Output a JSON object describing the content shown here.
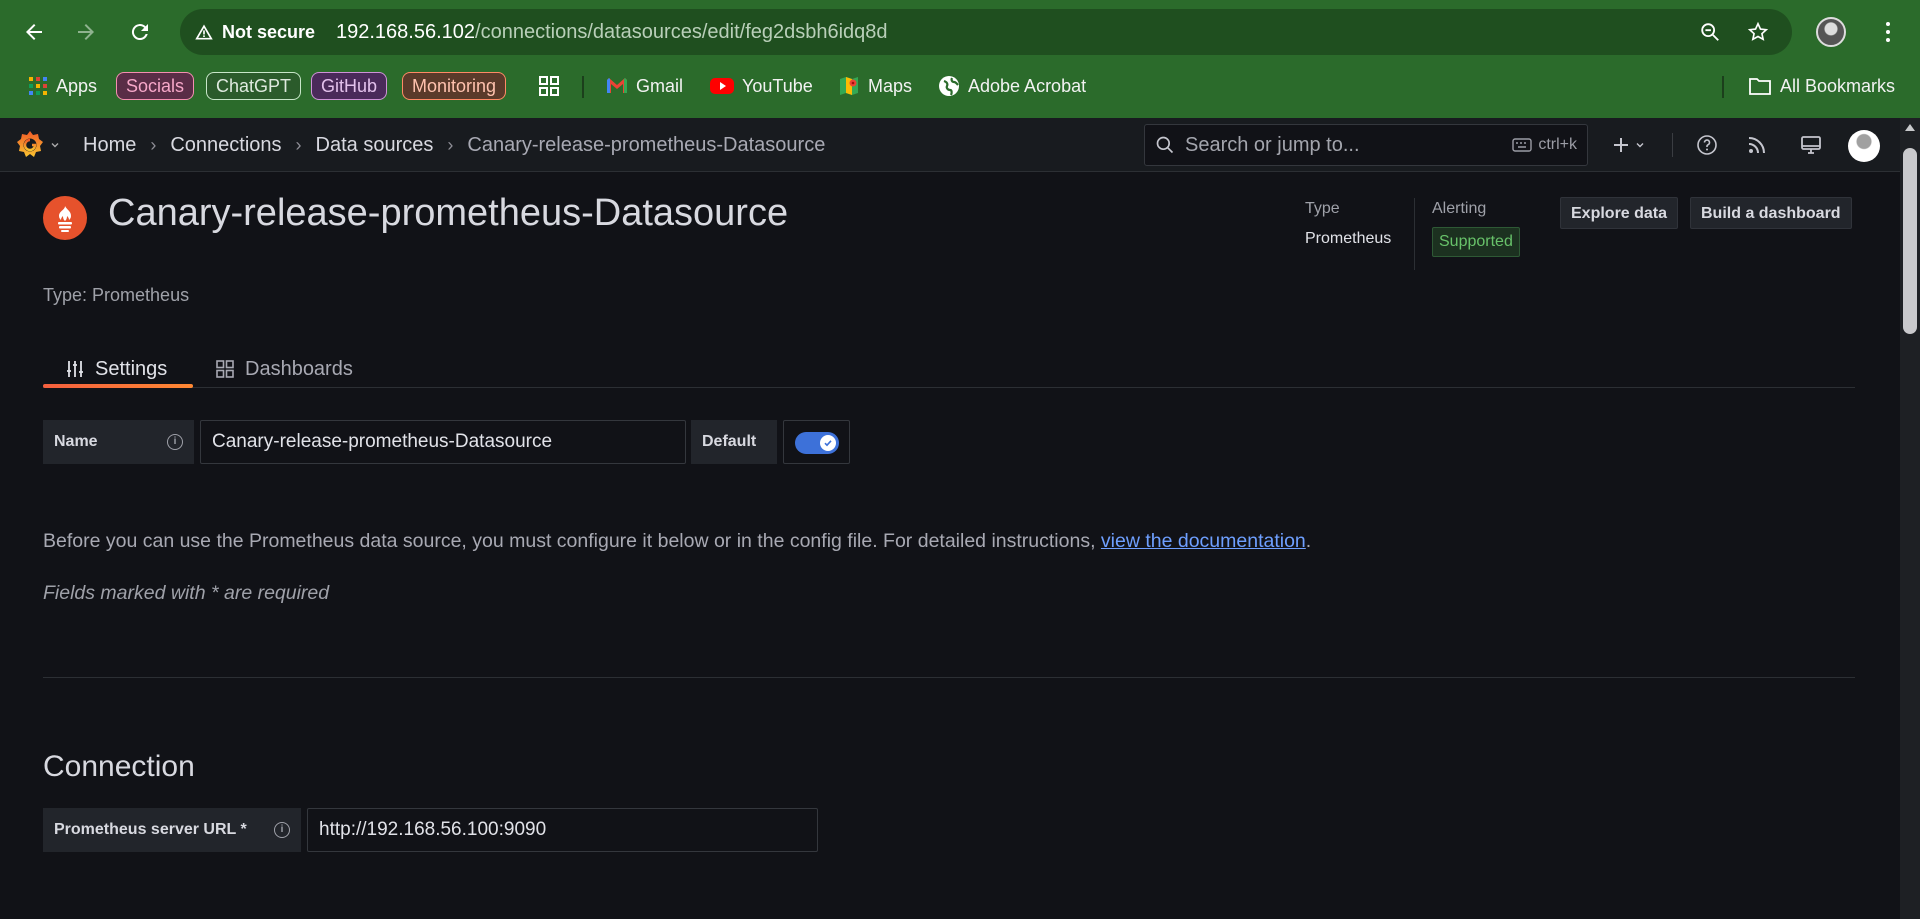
{
  "browser": {
    "security_label": "Not secure",
    "url_host": "192.168.56.102",
    "url_path": "/connections/datasources/edit/feg2dsbh6idq8d",
    "bookmarks": {
      "apps": "Apps",
      "chips": [
        {
          "label": "Socials",
          "color": "#f48fb1",
          "bg": "#5a2d47"
        },
        {
          "label": "ChatGPT",
          "color": "#c8e6c9",
          "bg": "#2b5b2b"
        },
        {
          "label": "GitHub",
          "color": "#ce93d8",
          "bg": "#4a2a5a"
        },
        {
          "label": "Monitoring",
          "color": "#ff8a65",
          "bg": "#5a3a2a"
        }
      ],
      "links": [
        {
          "label": "Gmail",
          "icon": "gmail-icon"
        },
        {
          "label": "YouTube",
          "icon": "youtube-icon"
        },
        {
          "label": "Maps",
          "icon": "maps-icon"
        },
        {
          "label": "Adobe Acrobat",
          "icon": "globe-icon"
        }
      ],
      "all_bookmarks": "All Bookmarks"
    }
  },
  "grafana": {
    "breadcrumbs": [
      "Home",
      "Connections",
      "Data sources",
      "Canary-release-prometheus-Datasource"
    ],
    "search_placeholder": "Search or jump to...",
    "search_shortcut": "ctrl+k"
  },
  "datasource": {
    "title": "Canary-release-prometheus-Datasource",
    "type_label": "Type",
    "type_value": "Prometheus",
    "alerting_label": "Alerting",
    "alerting_value": "Supported",
    "explore_button": "Explore data",
    "build_button": "Build a dashboard",
    "type_line": "Type: Prometheus",
    "accent_color": "#e6522c"
  },
  "tabs": [
    {
      "label": "Settings",
      "active": true
    },
    {
      "label": "Dashboards",
      "active": false
    }
  ],
  "form": {
    "name_label": "Name",
    "name_value": "Canary-release-prometheus-Datasource",
    "default_label": "Default",
    "default_enabled": true,
    "intro_before": "Before you can use the Prometheus data source, you must configure it below or in the config file. For detailed instructions, ",
    "intro_link": "view the documentation",
    "intro_after": ".",
    "required_note": "Fields marked with * are required",
    "connection_title": "Connection",
    "url_label": "Prometheus server URL *",
    "url_value": "http://192.168.56.100:9090"
  }
}
